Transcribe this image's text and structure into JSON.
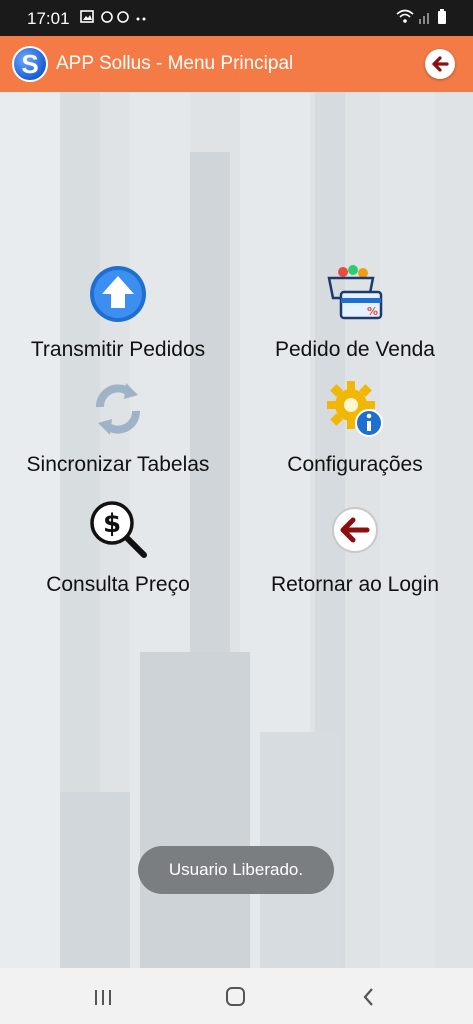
{
  "status_bar": {
    "time": "17:01"
  },
  "app_bar": {
    "logo_letter": "S",
    "title": "APP Sollus - Menu Principal"
  },
  "menu": {
    "transmit": "Transmitir Pedidos",
    "sales_order": "Pedido de Venda",
    "sync": "Sincronizar Tabelas",
    "settings": "Configurações",
    "price_lookup": "Consulta Preço",
    "back_login": "Retornar ao Login"
  },
  "toast": "Usuario Liberado.",
  "colors": {
    "app_bar": "#f47b46",
    "accent_red": "#8b0f0f",
    "icon_blue": "#1f6fd1"
  }
}
